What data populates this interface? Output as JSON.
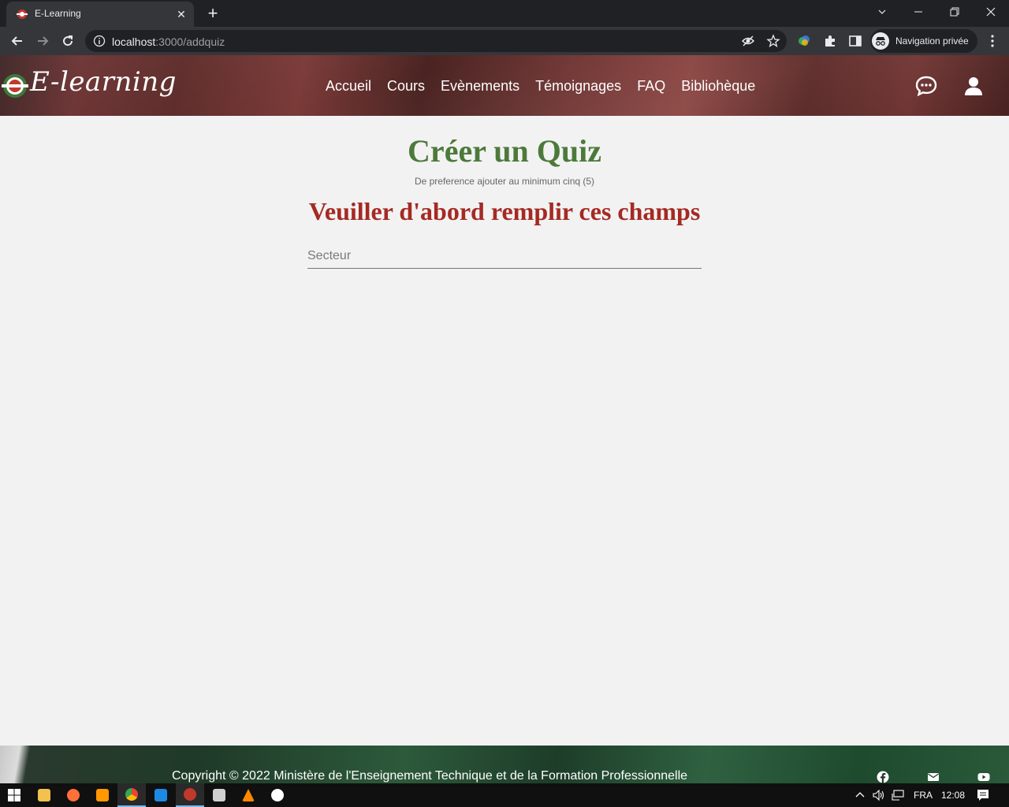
{
  "browser": {
    "tab_title": "E-Learning",
    "url_host": "localhost",
    "url_path": ":3000/addquiz",
    "profile_label": "Navigation privée"
  },
  "header": {
    "logo_text": "E-learning",
    "nav": [
      "Accueil",
      "Cours",
      "Evènements",
      "Témoignages",
      "FAQ",
      "Bibliohèque"
    ]
  },
  "main": {
    "title": "Créer un Quiz",
    "subtitle": "De preference ajouter au minimum cinq (5)",
    "section_title": "Veuiller d'abord remplir ces champs",
    "field": {
      "placeholder": "Secteur",
      "value": ""
    }
  },
  "footer": {
    "copyright": "Copyright © 2022 Ministère de l'Enseignement Technique et de la Formation Professionnelle",
    "social": [
      "facebook-icon",
      "mail-icon",
      "youtube-icon"
    ]
  },
  "taskbar": {
    "language": "FRA",
    "time": "12:08"
  },
  "colors": {
    "title_green": "#4d7a3a",
    "section_red": "#a52a22",
    "header_red": "#6a3030",
    "footer_green": "#2d5a3b"
  }
}
